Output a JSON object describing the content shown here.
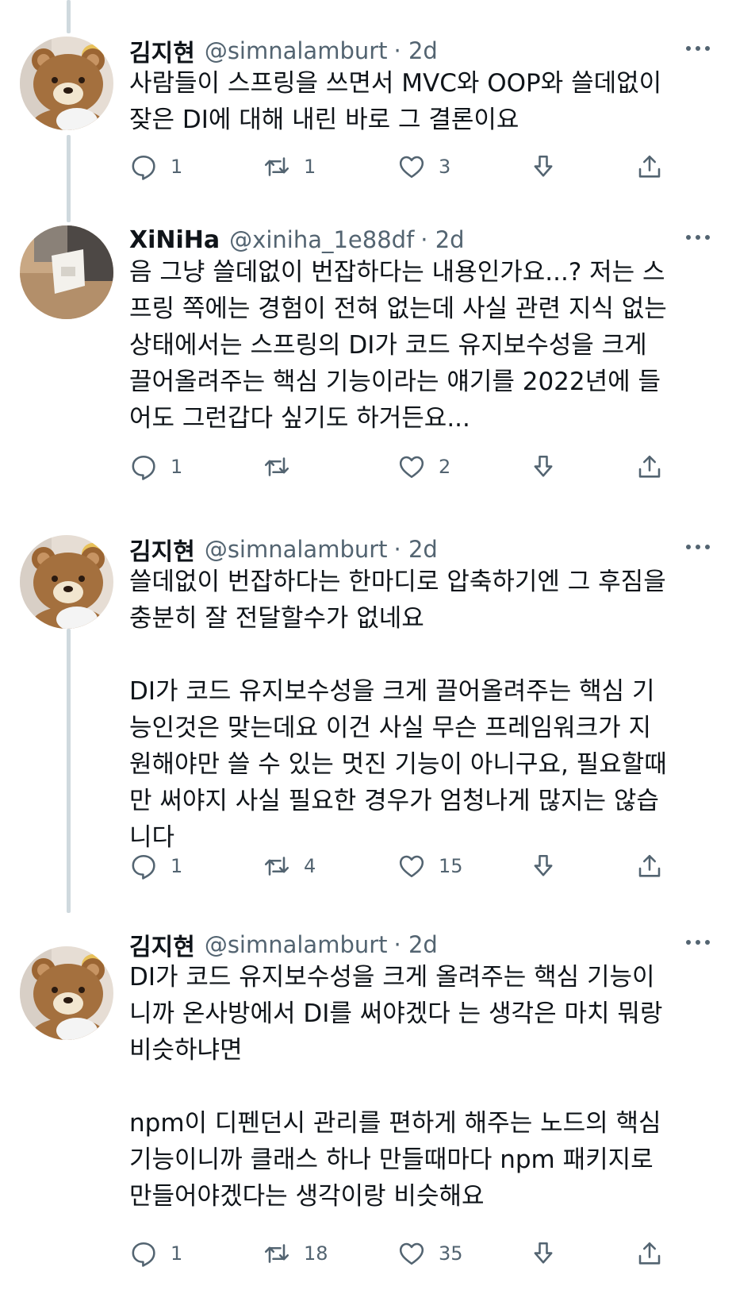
{
  "tweets": [
    {
      "name": "김지현",
      "handle": "@simnalamburt",
      "time": "· 2d",
      "avatar": "rilakkuma-bear-avatar",
      "lines": [
        "사람들이 스프링을 쓰면서 MVC와 OOP와 쓸데없이",
        "잦은 DI에 대해 내린 바로 그 결론이요"
      ],
      "replies": "1",
      "retweets": "1",
      "likes": "3"
    },
    {
      "name": "XiNiHa",
      "handle": "@xiniha_1e88df",
      "time": "· 2d",
      "avatar": "photo-avatar",
      "lines": [
        "음 그냥 쓸데없이 번잡하다는 내용인가요...? 저는 스",
        "프링 쪽에는 경험이 전혀 없는데 사실 관련 지식 없는",
        "상태에서는 스프링의 DI가 코드 유지보수성을 크게",
        "끌어올려주는 핵심 기능이라는 얘기를 2022년에 들",
        "어도 그런갑다 싶기도 하거든요..."
      ],
      "replies": "1",
      "retweets": "",
      "likes": "2"
    },
    {
      "name": "김지현",
      "handle": "@simnalamburt",
      "time": "· 2d",
      "avatar": "rilakkuma-bear-avatar",
      "lines": [
        "쓸데없이 번잡하다는 한마디로 압축하기엔 그 후짐을",
        "충분히 잘 전달할수가 없네요"
      ],
      "lines2": [
        "DI가 코드 유지보수성을 크게 끌어올려주는 핵심 기",
        "능인것은 맞는데요 이건 사실 무슨 프레임워크가 지",
        "원해야만 쓸 수 있는 멋진 기능이 아니구요, 필요할때",
        "만 써야지 사실 필요한 경우가 엄청나게 많지는 않습",
        "니다"
      ],
      "replies": "1",
      "retweets": "4",
      "likes": "15"
    },
    {
      "name": "김지현",
      "handle": "@simnalamburt",
      "time": "· 2d",
      "avatar": "rilakkuma-bear-avatar",
      "lines": [
        "DI가 코드 유지보수성을 크게 올려주는 핵심 기능이",
        "니까 온사방에서 DI를 써야겠다 는 생각은 마치 뭐랑",
        "비슷하냐면"
      ],
      "lines2": [
        "npm이 디펜던시 관리를 편하게 해주는 노드의 핵심",
        "기능이니까 클래스 하나 만들때마다 npm 패키지로",
        "만들어야겠다는 생각이랑 비슷해요"
      ],
      "replies": "1",
      "retweets": "18",
      "likes": "35"
    }
  ],
  "icons": {
    "reply": "reply-icon",
    "retweet": "retweet-icon",
    "like": "heart-icon",
    "download": "download-icon",
    "share": "share-icon",
    "more": "more-icon"
  },
  "colors": {
    "secondary": "#536471",
    "thread_line": "#cfd9de",
    "text": "#0f1419"
  }
}
